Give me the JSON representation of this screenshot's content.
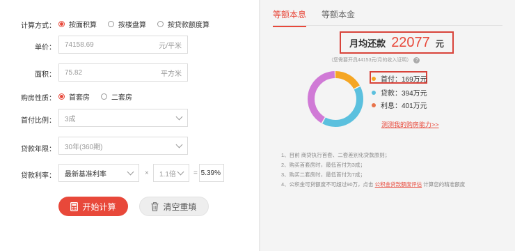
{
  "form": {
    "calc_method": {
      "label": "计算方式：",
      "options": [
        "按面积算",
        "按楼盘算",
        "按贷款额度算"
      ],
      "selected": 0
    },
    "unit_price": {
      "label": "单价：",
      "value": "74158.69",
      "unit": "元/平米"
    },
    "area": {
      "label": "面积：",
      "value": "75.82",
      "unit": "平方米"
    },
    "property_type": {
      "label": "购房性质：",
      "options": [
        "首套房",
        "二套房"
      ],
      "selected": 0
    },
    "down_payment": {
      "label": "首付比例：",
      "value": "3成"
    },
    "loan_term": {
      "label": "贷款年限：",
      "value": "30年(360期)"
    },
    "rate": {
      "label": "贷款利率：",
      "base": "最新基准利率",
      "times_symbol": "×",
      "multiplier": "1.1倍",
      "equals_symbol": "=",
      "result": "5.39%"
    },
    "calc_button": "开始计算",
    "clear_button": "清空重填"
  },
  "result": {
    "tabs": [
      "等额本息",
      "等额本金"
    ],
    "active_tab": 0,
    "monthly_label": "月均还款",
    "monthly_value": "22077",
    "monthly_unit": "元",
    "income_note": "（您需要开具44153元/月的收入证明）",
    "help_icon": "question-icon",
    "legend": [
      {
        "name": "首付：",
        "value": "169万元",
        "color": "#f5a623"
      },
      {
        "name": "贷款：",
        "value": "394万元",
        "color": "#5bc0de"
      },
      {
        "name": "利息：",
        "value": "401万元",
        "color": "#e8734a"
      }
    ],
    "capacity_link": "测测我的购房能力>>",
    "notes": [
      "1、目前  商贷执行首套、二套差别化贷款原则；",
      "2、购买首套房时，最低首付为3成；",
      "3、购买二套房时，最低首付为7成；"
    ],
    "note4_prefix": "4、公积金可贷额度不可超过90万，点击",
    "note4_link": "公积金贷款额度评估",
    "note4_suffix": "计算您的精准额度"
  },
  "chart_data": {
    "type": "pie",
    "title": "",
    "categories": [
      "首付",
      "贷款",
      "利息"
    ],
    "values": [
      169,
      394,
      401
    ],
    "colors": [
      "#f5a623",
      "#5bc0de",
      "#d07ad6"
    ]
  }
}
